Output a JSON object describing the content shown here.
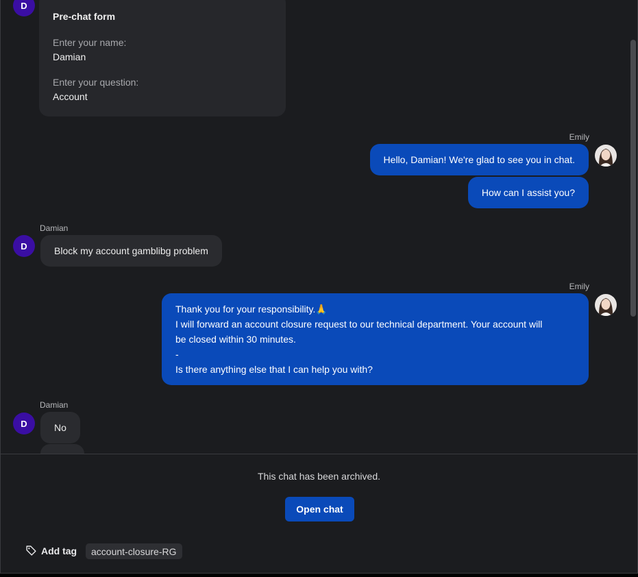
{
  "prechat_form": {
    "title": "Pre-chat form",
    "name_label": "Enter your name:",
    "name_value": "Damian",
    "question_label": "Enter your question:",
    "question_value": "Account"
  },
  "visitor": {
    "initial": "D",
    "name": "Damian"
  },
  "agent": {
    "name": "Emily"
  },
  "messages": [
    {
      "from": "agent",
      "text": "Hello, Damian! We're glad to see you in chat."
    },
    {
      "from": "agent",
      "text": "How can I assist you?"
    },
    {
      "from": "visitor",
      "text": "Block my account gamblibg problem"
    },
    {
      "from": "agent",
      "lines": [
        "Thank you for your responsibility.🙏",
        "I will forward an account closure request to our technical department. Your account will",
        "be closed within 30 minutes.",
        "-",
        "Is there anything else that I can help you with?"
      ]
    },
    {
      "from": "visitor",
      "text": "No"
    }
  ],
  "footer": {
    "archived_text": "This chat has been archived.",
    "open_chat_label": "Open chat",
    "add_tag_label": "Add tag",
    "tags": [
      "account-closure-RG"
    ]
  },
  "icons": {
    "tag": "tag-icon"
  },
  "colors": {
    "agent_bubble": "#0a4ab9",
    "visitor_avatar": "#3a0ea3",
    "background": "#1b1c1f"
  }
}
